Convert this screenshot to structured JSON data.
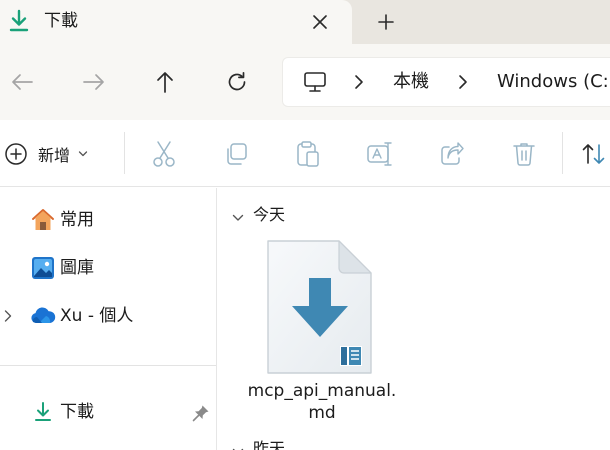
{
  "tab": {
    "title": "下載",
    "icon": "download-icon",
    "close_icon": "close-icon",
    "new_tab_icon": "plus-icon"
  },
  "nav": {
    "back_icon": "arrow-left-icon",
    "forward_icon": "arrow-right-icon",
    "up_icon": "arrow-up-icon",
    "refresh_icon": "refresh-icon"
  },
  "address": {
    "root_icon": "computer-icon",
    "crumbs": [
      "本機",
      "Windows (C:"
    ]
  },
  "toolbar": {
    "new_label": "新增",
    "new_icon": "plus-circle-icon",
    "buttons": [
      "cut-icon",
      "copy-icon",
      "paste-icon",
      "rename-icon",
      "share-icon",
      "delete-icon",
      "sort-icon"
    ]
  },
  "sidebar": {
    "items": [
      {
        "label": "常用",
        "icon": "home-icon"
      },
      {
        "label": "圖庫",
        "icon": "gallery-icon"
      },
      {
        "label": "Xu - 個人",
        "icon": "onedrive-cloud-icon",
        "expandable": true
      },
      {
        "label": "下載",
        "icon": "download-icon",
        "pinned": true
      }
    ]
  },
  "content": {
    "groups": [
      {
        "label": "今天",
        "files": [
          {
            "name": "mcp_api_manual.md",
            "icon": "markdown-file-icon"
          }
        ]
      },
      {
        "label": "昨天"
      }
    ]
  },
  "colors": {
    "accent": "#1aa179",
    "file_arrow": "#3f88b3",
    "tab_bar": "#e9e6e0",
    "chrome": "#f8f7f4",
    "toolbar_icons_disabled": "#9ab6c7"
  }
}
